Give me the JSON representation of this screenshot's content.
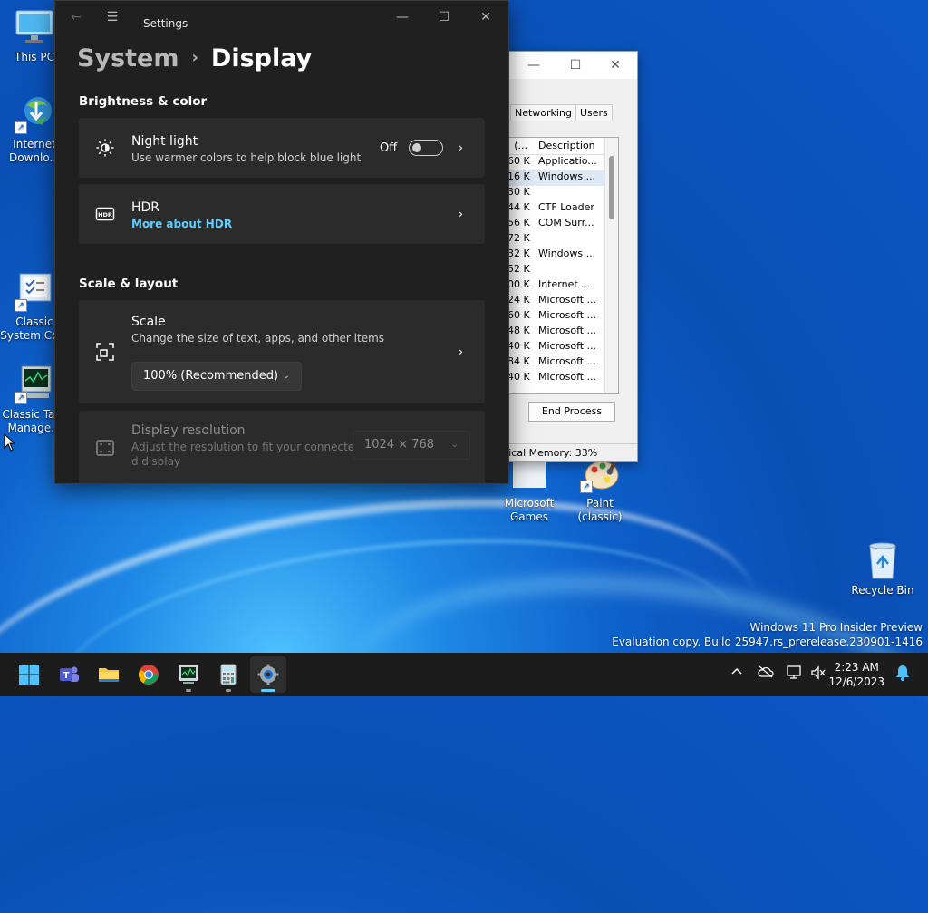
{
  "desktop": {
    "icons": [
      {
        "label": "This PC"
      },
      {
        "label": "Internet Downlo..."
      },
      {
        "label": "Classic System Co..."
      },
      {
        "label": "Classic Task Manage..."
      },
      {
        "label": "Microsoft Games"
      },
      {
        "label": "Paint (classic)"
      },
      {
        "label": "Recycle Bin"
      }
    ]
  },
  "watermark": {
    "line1": "Windows 11 Pro Insider Preview",
    "line2": "Evaluation copy. Build 25947.rs_prerelease.230901-1416"
  },
  "taskmgr": {
    "tabs": [
      "Networking",
      "Users"
    ],
    "header_mem": "(...",
    "header_desc": "Description",
    "rows": [
      {
        "mem": "60 K",
        "desc": "Applicatio..."
      },
      {
        "mem": "16 K",
        "desc": "Windows ..."
      },
      {
        "mem": "30 K",
        "desc": ""
      },
      {
        "mem": "44 K",
        "desc": "CTF Loader"
      },
      {
        "mem": "56 K",
        "desc": "COM Surr..."
      },
      {
        "mem": "72 K",
        "desc": ""
      },
      {
        "mem": "32 K",
        "desc": "Windows ..."
      },
      {
        "mem": "52 K",
        "desc": ""
      },
      {
        "mem": "00 K",
        "desc": "Internet ..."
      },
      {
        "mem": "24 K",
        "desc": "Microsoft ..."
      },
      {
        "mem": "60 K",
        "desc": "Microsoft ..."
      },
      {
        "mem": "48 K",
        "desc": "Microsoft ..."
      },
      {
        "mem": "40 K",
        "desc": "Microsoft ..."
      },
      {
        "mem": "84 K",
        "desc": "Microsoft ..."
      },
      {
        "mem": "40 K",
        "desc": "Microsoft ..."
      }
    ],
    "end_process": "End Process",
    "status": "ysical Memory: 33%"
  },
  "settings": {
    "app_title": "Settings",
    "breadcrumb_parent": "System",
    "breadcrumb_current": "Display",
    "brightness_section": "Brightness & color",
    "night_light": {
      "title": "Night light",
      "subtitle": "Use warmer colors to help block blue light",
      "state": "Off"
    },
    "hdr": {
      "title": "HDR",
      "link": "More about HDR"
    },
    "scale_section": "Scale & layout",
    "scale": {
      "title": "Scale",
      "subtitle": "Change the size of text, apps, and other items",
      "value": "100% (Recommended)"
    },
    "resolution": {
      "title": "Display resolution",
      "subtitle_line1": "Adjust the resolution to fit your connecte",
      "subtitle_line2": "d display",
      "value": "1024 × 768"
    }
  },
  "taskbar": {
    "apps": [
      "start",
      "teams",
      "file-explorer",
      "chrome",
      "classic-task-manager",
      "calculator",
      "settings"
    ],
    "active_app": "settings",
    "time": "2:23 AM",
    "date": "12/6/2023"
  },
  "colors": {
    "accent": "#60cdff",
    "settings_bg": "#202020",
    "card_bg": "#2b2b2b"
  }
}
